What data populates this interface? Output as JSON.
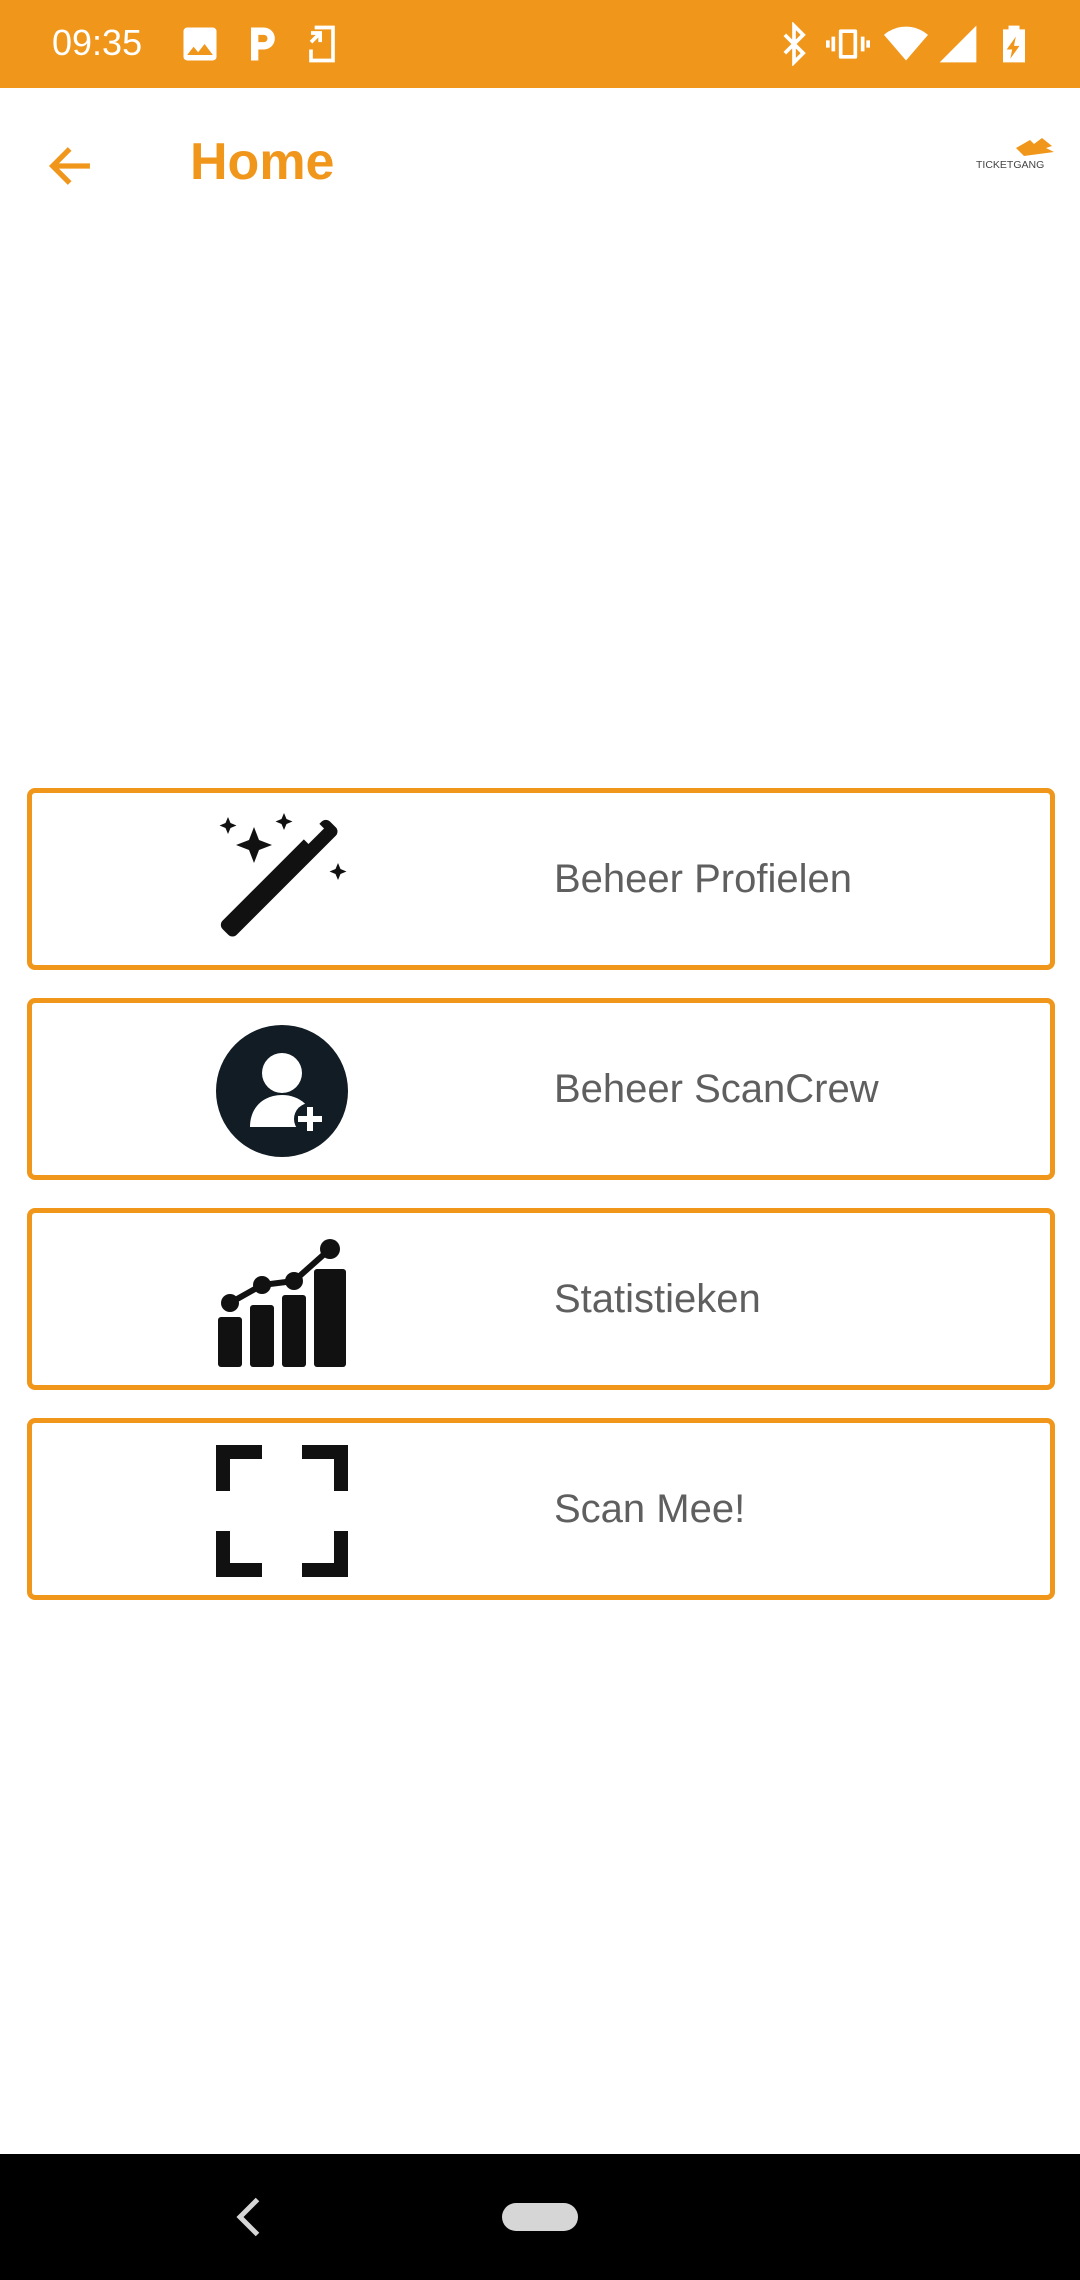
{
  "status_bar": {
    "time": "09:35",
    "left_icons": [
      "image-icon",
      "parking-icon",
      "screen-cast-icon"
    ],
    "right_icons": [
      "bluetooth-icon",
      "vibrate-icon",
      "wifi-icon",
      "cell-signal-icon",
      "battery-charging-icon"
    ],
    "background": "#f0961b"
  },
  "app_bar": {
    "title": "Home",
    "back_icon": "arrow-back-icon",
    "logo_text": "TICKETGANG",
    "accent": "#f0961b"
  },
  "menu": {
    "items": [
      {
        "label": "Beheer Profielen",
        "icon": "magic-wand-icon"
      },
      {
        "label": "Beheer ScanCrew",
        "icon": "add-user-icon"
      },
      {
        "label": "Statistieken",
        "icon": "statistics-chart-icon"
      },
      {
        "label": "Scan Mee!",
        "icon": "scan-frame-icon"
      }
    ]
  },
  "nav_bar": {
    "back_icon": "chevron-left-icon",
    "home_icon": "home-pill-icon"
  }
}
